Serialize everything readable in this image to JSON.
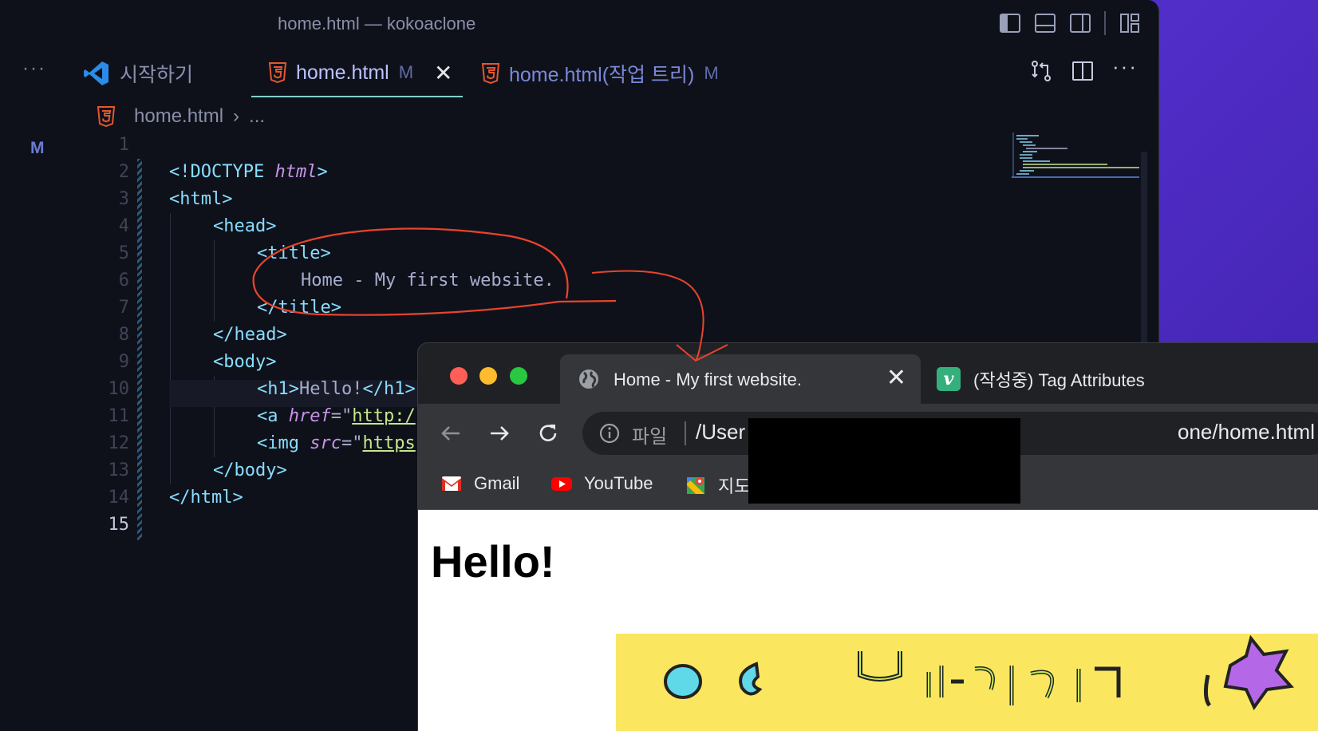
{
  "vscode": {
    "window_title": "home.html — kokoaclone",
    "tabs": [
      {
        "label": "시작하기",
        "icon": "vscode-icon"
      },
      {
        "label": "home.html",
        "badge": "M",
        "icon": "html5-icon"
      },
      {
        "label": "home.html(작업 트리)",
        "badge": "M",
        "icon": "html5-icon"
      }
    ],
    "breadcrumb": {
      "file": "home.html",
      "rest": "..."
    },
    "gutter_badge": "M",
    "line_numbers": [
      "1",
      "2",
      "3",
      "4",
      "5",
      "6",
      "7",
      "8",
      "9",
      "10",
      "11",
      "12",
      "13",
      "14",
      "15"
    ],
    "code": {
      "l2": {
        "open": "<!DOCTYPE ",
        "kw": "html",
        "close": ">"
      },
      "l3": "<html>",
      "l4": "<head>",
      "l5": "<title>",
      "l6": "Home - My first website.",
      "l7": "</title>",
      "l8": "</head>",
      "l9": "<body>",
      "l10": {
        "open": "<h1>",
        "text": "Hello!",
        "close": "</h1>"
      },
      "l11": {
        "open": "<a ",
        "attr": "href",
        "eq": "=\"",
        "str": "http:/"
      },
      "l12": {
        "open": "<img ",
        "attr": "src",
        "eq": "=\"",
        "str": "https"
      },
      "l13": "</body>",
      "l14": "</html>"
    }
  },
  "browser": {
    "tabs": [
      {
        "title": "Home - My first website.",
        "icon": "globe-icon"
      },
      {
        "title": "(작성중) Tag Attributes",
        "icon": "v-icon",
        "icon_letter": "v"
      }
    ],
    "address": {
      "scheme": "파일",
      "url_start": "/User",
      "url_end": "one/home.html"
    },
    "bookmarks": [
      {
        "label": "Gmail",
        "icon": "gmail-icon"
      },
      {
        "label": "YouTube",
        "icon": "youtube-icon"
      },
      {
        "label": "지도",
        "icon": "maps-icon"
      }
    ],
    "page": {
      "heading": "Hello!"
    }
  },
  "colors": {
    "editor_bg": "#0f111a",
    "tag": "#89ddff",
    "attribute": "#c792ea",
    "string": "#c3e88d",
    "annotation": "#e8442c",
    "desktop": "#5b34d6",
    "chrome_bg": "#35363a"
  }
}
